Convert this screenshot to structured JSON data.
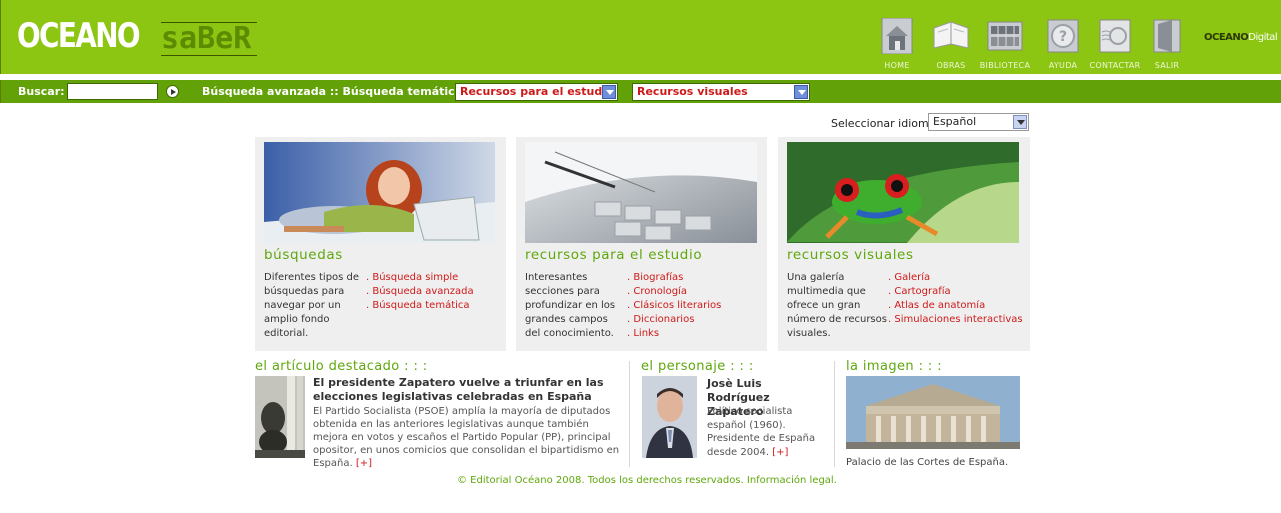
{
  "header": {
    "logo_main": "OCEANO",
    "logo_saber": "saBeR",
    "nav": [
      {
        "label": "HOME",
        "icon": "house-icon"
      },
      {
        "label": "OBRAS",
        "icon": "book-icon"
      },
      {
        "label": "BIBLIOTECA",
        "icon": "library-icon"
      },
      {
        "label": "AYUDA",
        "icon": "help-icon"
      },
      {
        "label": "CONTACTAR",
        "icon": "envelope-icon"
      },
      {
        "label": "SALIR",
        "icon": "exit-door-icon"
      }
    ],
    "brand_main": "OCEANO",
    "brand_digital": "Digital"
  },
  "searchbar": {
    "label": "Buscar:",
    "input_value": "",
    "advanced_links": "Búsqueda avanzada :: Búsqueda temática",
    "select_estudio": "Recursos para el estudio",
    "select_visuales": "Recursos visuales"
  },
  "language": {
    "label": "Seleccionar idioma:",
    "selected": "Español"
  },
  "cards": [
    {
      "title": "búsquedas",
      "description": "Diferentes tipos de búsquedas para navegar por un amplio fondo editorial.",
      "links": [
        ". Búsqueda simple",
        ". Búsqueda avanzada",
        ". Búsqueda temática"
      ]
    },
    {
      "title": "recursos para el estudio",
      "description": "Interesantes secciones para profundizar en los grandes campos del conocimiento.",
      "links": [
        ". Biografías",
        ". Cronología",
        ". Clásicos literarios",
        ". Diccionarios",
        ". Links"
      ]
    },
    {
      "title": "recursos visuales",
      "description": "Una galería multimedia que ofrece un gran número de recursos visuales.",
      "links": [
        ". Galería",
        ". Cartografía",
        ". Atlas de anatomía",
        ". Simulaciones interactivas"
      ]
    }
  ],
  "articulo": {
    "section_title": "el artículo destacado : : :",
    "headline": "El presidente Zapatero vuelve a triunfar en las elecciones legislativas celebradas en España",
    "body": "El Partido Socialista (PSOE) amplía la mayoría de diputados obtenida en las anteriores legislativas aunque también mejora en votos y escaños el Partido Popular (PP), principal opositor, en unos comicios que consolidan el bipartidismo en España.",
    "more": "[+]"
  },
  "personaje": {
    "section_title": "el personaje : : :",
    "name": "Josè Luis Rodríguez Zapatero",
    "body": "Político socialista español (1960). Presidente de España desde 2004.",
    "more": "[+]"
  },
  "imagen": {
    "section_title": "la imagen : : :",
    "caption": "Palacio de las Cortes de España."
  },
  "footer": "© Editorial Océano 2008. Todos los derechos reservados. Información legal.",
  "colors": {
    "header_green": "#8cc512",
    "bar_green": "#62a108",
    "accent_green": "#5fa70d",
    "link_red": "#d01919"
  }
}
